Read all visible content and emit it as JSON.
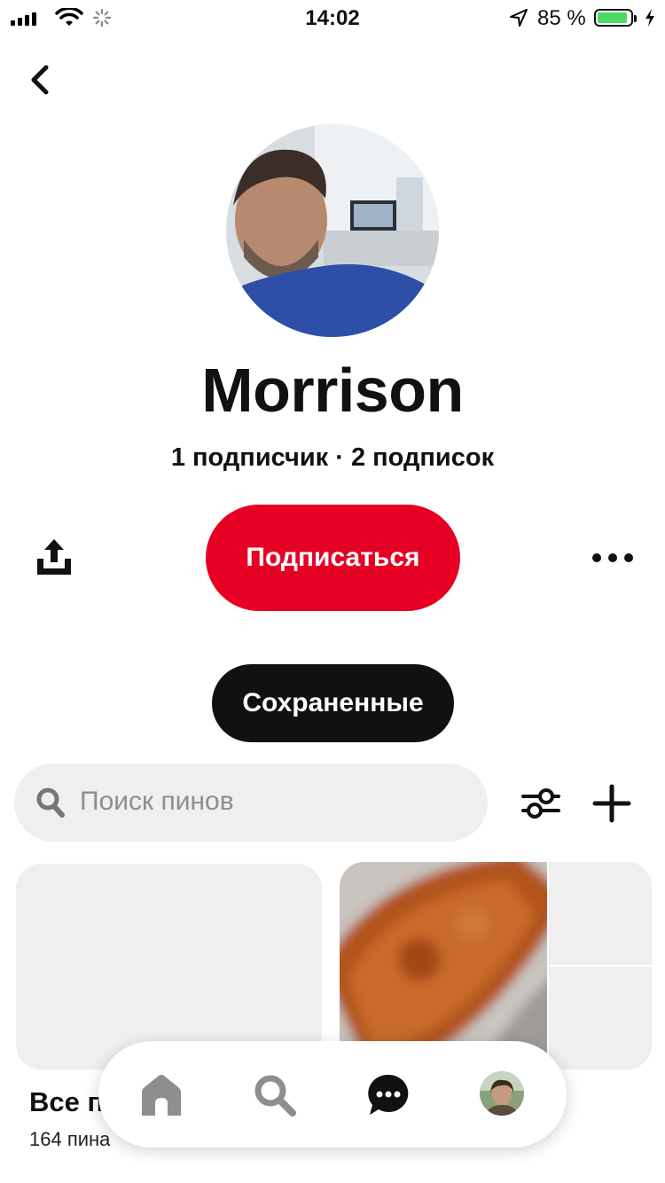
{
  "status_bar": {
    "time": "14:02",
    "battery_percent": "85 %"
  },
  "profile": {
    "name": "Morrison",
    "stats": "1 подписчик · 2 подписок",
    "follow_label": "Подписаться"
  },
  "tabs": {
    "active_label": "Сохраненные"
  },
  "search": {
    "placeholder": "Поиск пинов"
  },
  "boards": [
    {
      "title": "Все п",
      "count": "164 пина"
    }
  ],
  "colors": {
    "accent": "#e60023",
    "tab_bg": "#111111",
    "surface": "#efefef",
    "battery": "#4cd964"
  },
  "icons": {
    "back": "chevron-left-icon",
    "share": "share-upload-icon",
    "more": "more-dots-icon",
    "search": "search-icon",
    "filter": "filter-sliders-icon",
    "add": "plus-icon",
    "nav": [
      "home-icon",
      "search-icon",
      "messages-icon",
      "profile-avatar"
    ]
  }
}
